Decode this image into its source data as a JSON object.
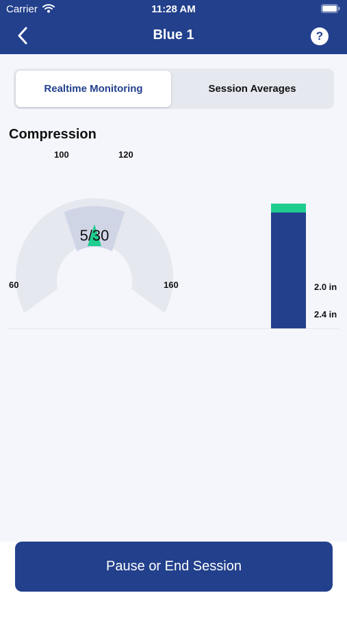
{
  "status_bar": {
    "carrier": "Carrier",
    "time": "11:28 AM"
  },
  "nav": {
    "title": "Blue 1",
    "help": "?"
  },
  "tabs": [
    {
      "label": "Realtime Monitoring",
      "active": true
    },
    {
      "label": "Session Averages",
      "active": false
    }
  ],
  "compression": {
    "title": "Compression",
    "rate_gauge": {
      "tick_labels": {
        "min": "60",
        "target_low": "100",
        "target_high": "120",
        "max": "160"
      },
      "count": "5/30",
      "colors": {
        "background_arc": "#e6e8f0",
        "target_zone": "#d0d5e6",
        "indicator": "#1fcd8f"
      }
    },
    "depth_bar": {
      "labels": {
        "upper": "2.0 in",
        "lower": "2.4 in"
      },
      "colors": {
        "fill": "#22408c",
        "marker": "#1fcd8f",
        "track": "#e6e8f0"
      }
    }
  },
  "footer": {
    "pause_label": "Pause or End Session"
  },
  "colors": {
    "primary": "#22408c",
    "accent": "#1fcd8f",
    "background": "#f5f6fc"
  }
}
